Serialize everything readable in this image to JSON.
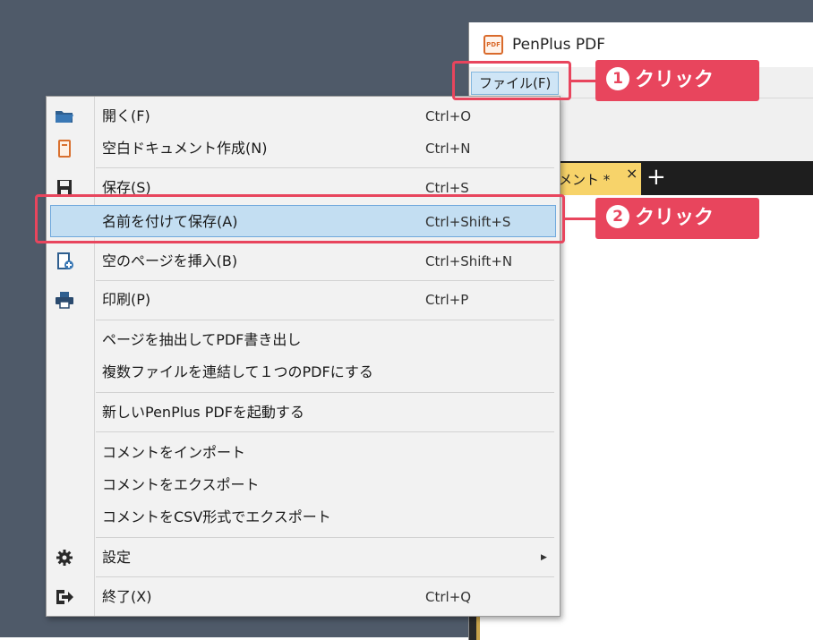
{
  "window": {
    "logo_text": "PDF",
    "title": "PenPlus PDF"
  },
  "menubar": {
    "file_label": "ファイル(F)"
  },
  "tabs": {
    "doc_tab_label": "メント *",
    "close_glyph": "×",
    "add_glyph": "+"
  },
  "file_menu": {
    "items": [
      {
        "label": "開く(F)",
        "shortcut": "Ctrl+O",
        "icon": "folder-open-icon"
      },
      {
        "label": "空白ドキュメント作成(N)",
        "shortcut": "Ctrl+N",
        "icon": "new-document-icon"
      },
      {
        "label": "保存(S)",
        "shortcut": "Ctrl+S",
        "icon": "save-icon"
      },
      {
        "label": "名前を付けて保存(A)",
        "shortcut": "Ctrl+Shift+S",
        "highlighted": true
      },
      {
        "label": "空のページを挿入(B)",
        "shortcut": "Ctrl+Shift+N",
        "icon": "insert-page-icon"
      },
      {
        "label": "印刷(P)",
        "shortcut": "Ctrl+P",
        "icon": "printer-icon"
      },
      {
        "label": "ページを抽出してPDF書き出し",
        "shortcut": ""
      },
      {
        "label": "複数ファイルを連結して１つのPDFにする",
        "shortcut": ""
      },
      {
        "label": "新しいPenPlus PDFを起動する",
        "shortcut": ""
      },
      {
        "label": "コメントをインポート",
        "shortcut": ""
      },
      {
        "label": "コメントをエクスポート",
        "shortcut": ""
      },
      {
        "label": "コメントをCSV形式でエクスポート",
        "shortcut": ""
      },
      {
        "label": "設定",
        "shortcut": "",
        "icon": "gear-icon",
        "submenu_arrow": "▶"
      },
      {
        "label": "終了(X)",
        "shortcut": "Ctrl+Q",
        "icon": "exit-icon"
      }
    ]
  },
  "annotations": {
    "step1": {
      "number": "1",
      "text": "クリック"
    },
    "step2": {
      "number": "2",
      "text": "クリック"
    },
    "color": "#e8455d"
  },
  "colors": {
    "desktop": "#4f5a69",
    "highlight": "#c3def2",
    "tab_active": "#f7d36a"
  }
}
